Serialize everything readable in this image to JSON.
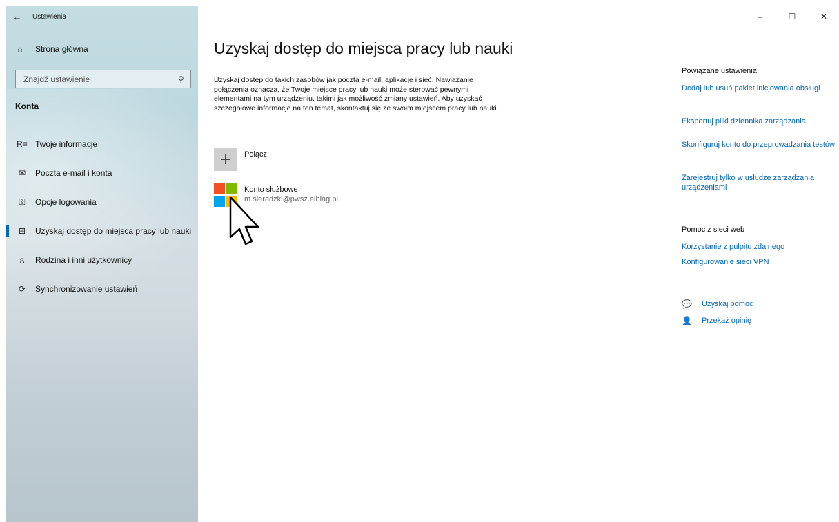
{
  "window": {
    "title": "Ustawienia",
    "controls": {
      "minimize": "–",
      "maximize": "☐",
      "close": "✕"
    }
  },
  "sidebar": {
    "back_icon": "arrow-left-icon",
    "home": {
      "label": "Strona główna",
      "icon": "home-icon"
    },
    "search": {
      "placeholder": "Znajdź ustawienie",
      "icon": "search-icon"
    },
    "section_title": "Konta",
    "items": [
      {
        "label": "Twoje informacje",
        "icon": "person-info-icon",
        "glyph": "R≡",
        "active": false
      },
      {
        "label": "Poczta e-mail i konta",
        "icon": "mail-icon",
        "glyph": "✉",
        "active": false
      },
      {
        "label": "Opcje logowania",
        "icon": "key-icon",
        "glyph": "⚿",
        "active": false
      },
      {
        "label": "Uzyskaj dostęp do miejsca pracy lub nauki",
        "icon": "briefcase-icon",
        "glyph": "⊟",
        "active": true
      },
      {
        "label": "Rodzina i inni użytkownicy",
        "icon": "add-person-icon",
        "glyph": "ጸ",
        "active": false
      },
      {
        "label": "Synchronizowanie ustawień",
        "icon": "sync-icon",
        "glyph": "⟳",
        "active": false
      }
    ]
  },
  "main": {
    "title": "Uzyskaj dostęp do miejsca pracy lub nauki",
    "description": "Uzyskaj dostęp do takich zasobów jak poczta e-mail, aplikacje i sieć. Nawiązanie połączenia oznacza, że Twoje miejsce pracy lub nauki może sterować pewnymi elementami na tym urządzeniu, takimi jak możliwość zmiany ustawień. Aby uzyskać szczegółowe informacje na ten temat, skontaktuj się ze swoim miejscem pracy lub nauki.",
    "connect_label": "Połącz",
    "account": {
      "name": "Konto służbowe",
      "email": "m.sieradzki@pwsz.elblag.pl"
    }
  },
  "right": {
    "related_heading": "Powiązane ustawienia",
    "related_links": [
      "Dodaj lub usuń pakiet inicjowania obsługi",
      "Eksportuj pliki dziennika zarządzania",
      "Skonfiguruj konto do przeprowadzania testów",
      "Zarejestruj tylko w usłudze zarządzania urządzeniami"
    ],
    "web_heading": "Pomoc z sieci web",
    "web_links": [
      "Korzystanie z pulpitu zdalnego",
      "Konfigurowanie sieci VPN"
    ],
    "help_label": "Uzyskaj pomoc",
    "feedback_label": "Przekaż opinię"
  },
  "colors": {
    "accent": "#0067b8",
    "ms_red": "#f25022",
    "ms_green": "#7fba00",
    "ms_blue": "#00a4ef",
    "ms_yellow": "#ffb900"
  }
}
